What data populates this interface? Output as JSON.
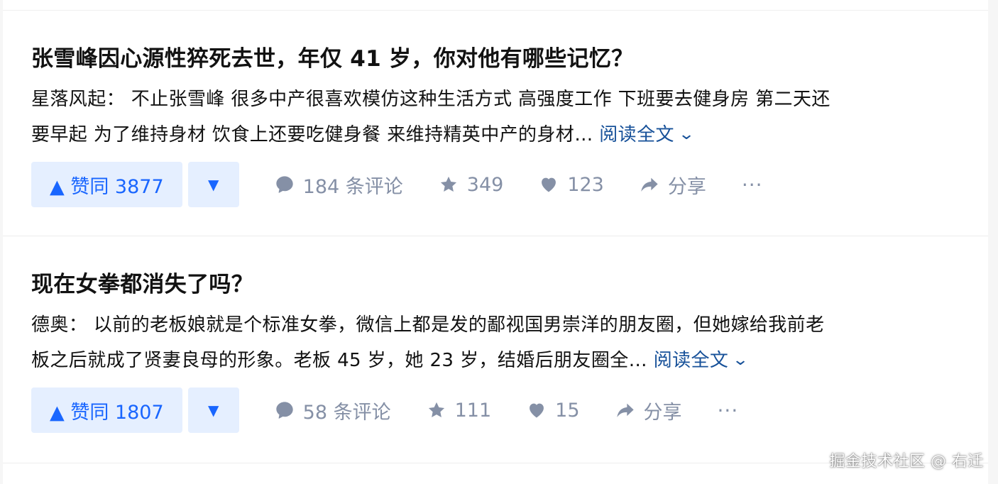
{
  "answers": [
    {
      "question": "张雪峰因心源性猝死去世，年仅 41 岁，你对他有哪些记忆？",
      "author": "星落风起：",
      "excerpt_line1": "不止张雪峰 很多中产很喜欢模仿这种生活方式 高强度工作 下班要去健身房 第二天还",
      "excerpt_line2": "要早起 为了维持身材 饮食上还要吃健身餐 来维持精英中产的身材…",
      "read_more": "阅读全文",
      "upvote_label": "▲ 赞同 3877",
      "downvote_glyph": "▼",
      "comments": "184 条评论",
      "favorites": "349",
      "likes": "123",
      "share": "分享",
      "more": "···"
    },
    {
      "question": "现在女拳都消失了吗？",
      "author": "德奥：",
      "excerpt_line1": "以前的老板娘就是个标准女拳，微信上都是发的鄙视国男崇洋的朋友圈，但她嫁给我前老",
      "excerpt_line2": "板之后就成了贤妻良母的形象。老板 45 岁，她 23 岁，结婚后朋友圈全…",
      "read_more": "阅读全文",
      "upvote_label": "▲ 赞同 1807",
      "downvote_glyph": "▼",
      "comments": "58 条评论",
      "favorites": "111",
      "likes": "15",
      "share": "分享",
      "more": "···"
    }
  ],
  "watermark": "掘金技术社区 @ 右迁",
  "colors": {
    "accent": "#1966ff",
    "accent_bg": "#e5efff",
    "link": "#175199",
    "muted": "#8590a6",
    "text": "#121212"
  },
  "icons": [
    "comment-icon",
    "star-icon",
    "heart-icon",
    "share-icon",
    "chevron-down-icon"
  ]
}
